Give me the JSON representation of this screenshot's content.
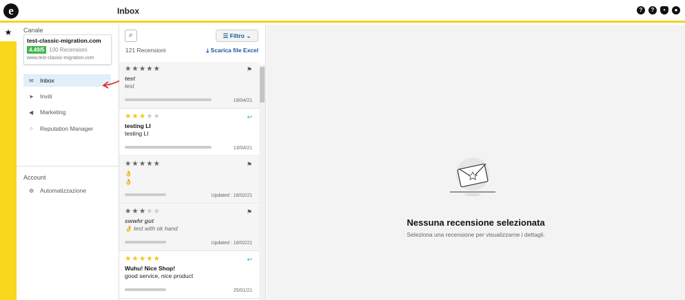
{
  "app": {
    "logo": "e",
    "title": "Inbox"
  },
  "header_icons": [
    "help-circle-icon",
    "question-icon",
    "bell-icon",
    "user-icon"
  ],
  "rail": {
    "star": "★"
  },
  "sidebar": {
    "channel_label": "Canale",
    "channel": {
      "name": "test-classic-migration.com",
      "score": "4.49/5",
      "reviews": "100 Recensioni",
      "url": "www.test-classic-migration.com"
    },
    "nav": [
      {
        "label": "Inbox",
        "icon": "inbox-icon"
      },
      {
        "label": "Inviti",
        "icon": "send-icon"
      },
      {
        "label": "Marketing",
        "icon": "megaphone-icon"
      },
      {
        "label": "Reputation Manager",
        "icon": "network-icon"
      }
    ],
    "account_label": "Account",
    "account_nav": [
      {
        "label": "Automatizzazione",
        "icon": "robot-icon"
      }
    ]
  },
  "list": {
    "filter_label": "Filtro",
    "count": "121 Recensioni",
    "excel": "Scarica file Excel",
    "reviews": [
      {
        "rating": 0,
        "title": "test",
        "body": "test",
        "date": "19/04/21",
        "icon": "flag-icon"
      },
      {
        "rating": 3,
        "title": "testing LI",
        "body": "testing LI",
        "date": "13/04/21",
        "icon": "reply-icon"
      },
      {
        "rating": 0,
        "title": "👌",
        "body": "👌",
        "date": "Updated : 16/02/21",
        "icon": "flag-icon"
      },
      {
        "rating": 3,
        "title": "swwhr gut",
        "body": "👌 test with ok hand",
        "date": "Updated : 16/02/21",
        "icon": "flag-icon"
      },
      {
        "rating": 5,
        "title": "Wuhu! Nice Shop!",
        "body": "good service, nice product",
        "date": "25/01/21",
        "icon": "reply-icon"
      }
    ]
  },
  "detail": {
    "empty_title": "Nessuna recensione selezionata",
    "empty_sub": "Seleziona una recensione per visualizzarne i dettagli."
  },
  "colors": {
    "accent_yellow": "#f8d71c",
    "link_blue": "#1a56a0",
    "score_green": "#3fb64e",
    "star_gold": "#f5c518",
    "reply_teal": "#1aa3c4",
    "annotation_red": "#e02020"
  }
}
